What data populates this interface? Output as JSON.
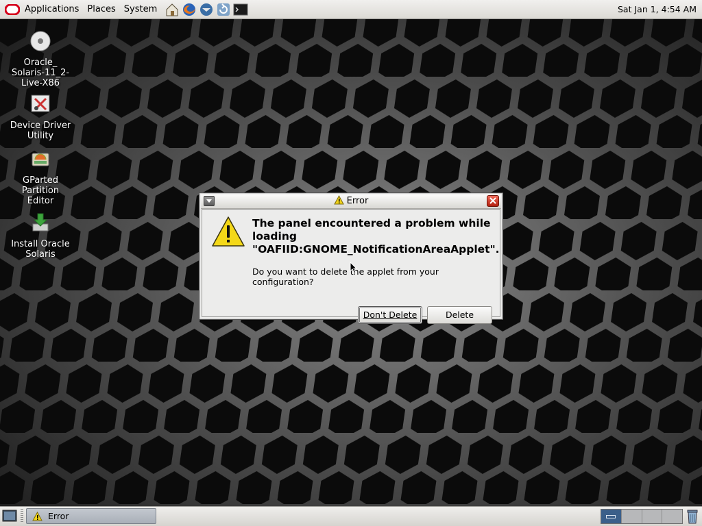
{
  "top_panel": {
    "menus": [
      "Applications",
      "Places",
      "System"
    ],
    "launchers": [
      "home-folder-icon",
      "firefox-icon",
      "thunderbird-icon",
      "update-manager-icon",
      "terminal-icon"
    ],
    "clock": "Sat Jan  1,  4:54 AM"
  },
  "desktop_icons": [
    {
      "label": "Oracle_\nSolaris-11_2-\nLive-X86",
      "icon": "disc-icon"
    },
    {
      "label": "Device Driver\nUtility",
      "icon": "device-driver-icon"
    },
    {
      "label": "GParted\nPartition\nEditor",
      "icon": "gparted-icon"
    },
    {
      "label": "Install Oracle\nSolaris",
      "icon": "install-icon"
    }
  ],
  "dialog": {
    "title": "Error",
    "heading": "The panel encountered a problem while loading \"OAFIID:GNOME_NotificationAreaApplet\".",
    "message": "Do you want to delete the applet from your configuration?",
    "buttons": {
      "dont_delete": "Don't Delete",
      "delete": "Delete"
    }
  },
  "bottom_panel": {
    "task_label": "Error",
    "workspaces": 4,
    "active_workspace": 1
  },
  "colors": {
    "panel": "#dcdad5",
    "close_button": "#c8341f",
    "warning": "#f0d21a"
  }
}
